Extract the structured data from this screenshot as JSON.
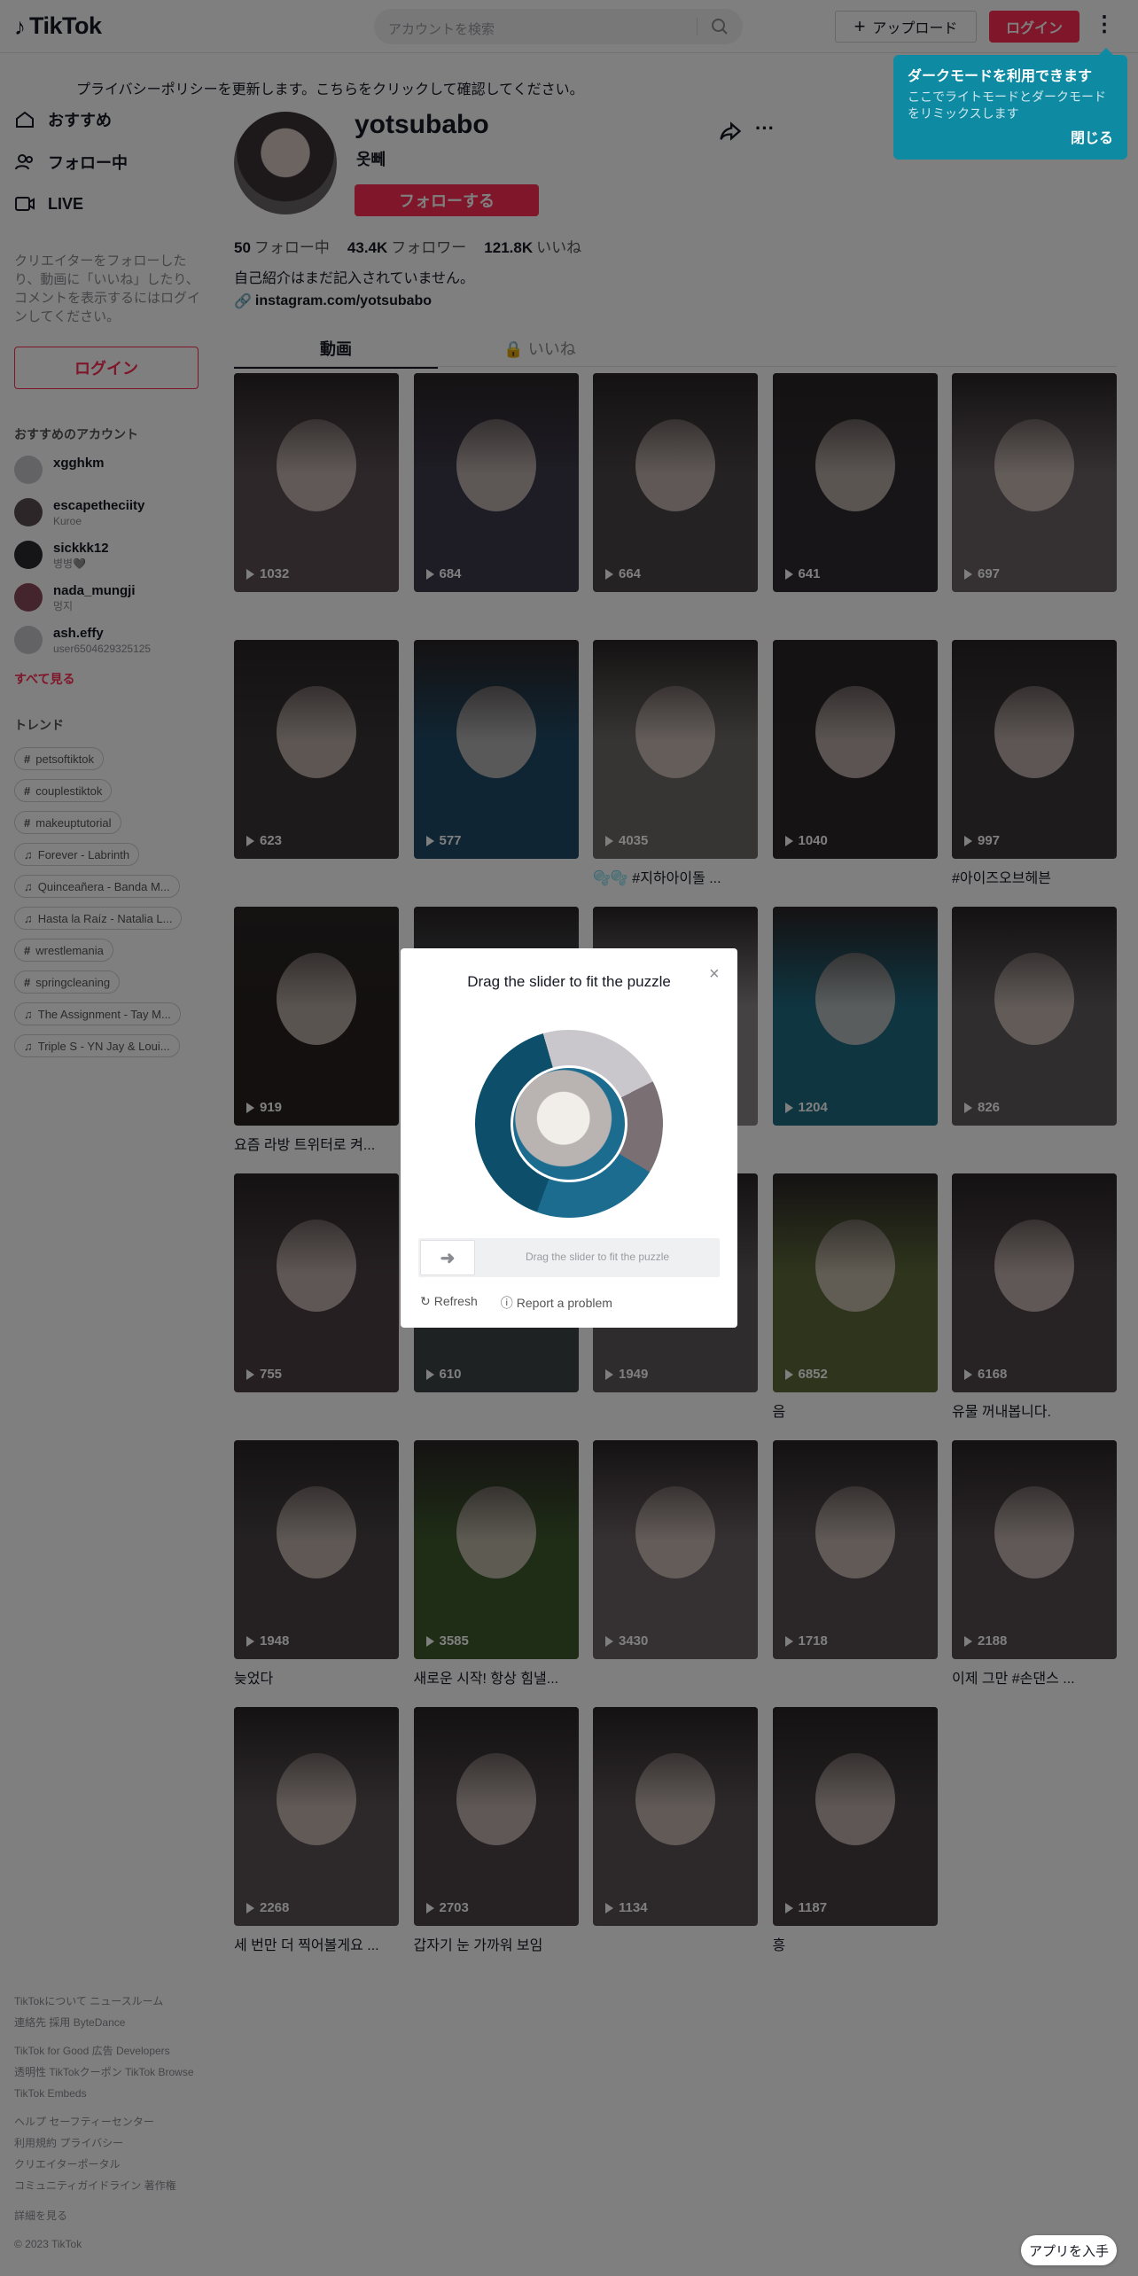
{
  "header": {
    "logo_text": "TikTok",
    "search_placeholder": "アカウントを検索",
    "upload_label": "アップロード",
    "login_label": "ログイン"
  },
  "banner": {
    "text": "プライバシーポリシーを更新します。こちらをクリックして確認してください。"
  },
  "sidebar": {
    "nav": [
      {
        "label": "おすすめ",
        "icon": "home-icon"
      },
      {
        "label": "フォロー中",
        "icon": "users-icon"
      },
      {
        "label": "LIVE",
        "icon": "live-icon"
      }
    ],
    "note": "クリエイターをフォローしたり、動画に「いいね」したり、コメントを表示するにはログインしてください。",
    "login_label": "ログイン",
    "suggested_heading": "おすすめのアカウント",
    "accounts": [
      {
        "name": "xgghkm",
        "sub": ""
      },
      {
        "name": "escapetheciity",
        "sub": "Kuroe"
      },
      {
        "name": "sickkk12",
        "sub": "병병🩶"
      },
      {
        "name": "nada_mungji",
        "sub": "멍지"
      },
      {
        "name": "ash.effy",
        "sub": "user6504629325125"
      }
    ],
    "see_all": "すべて見る",
    "trending_heading": "トレンド",
    "tags": [
      {
        "type": "hashtag",
        "label": "petsoftiktok"
      },
      {
        "type": "hashtag",
        "label": "couplestiktok"
      },
      {
        "type": "hashtag",
        "label": "makeuptutorial"
      },
      {
        "type": "music",
        "label": "Forever - Labrinth"
      },
      {
        "type": "music",
        "label": "Quinceañera - Banda M..."
      },
      {
        "type": "music",
        "label": "Hasta la Raíz - Natalia L..."
      },
      {
        "type": "hashtag",
        "label": "wrestlemania"
      },
      {
        "type": "hashtag",
        "label": "springcleaning"
      },
      {
        "type": "music",
        "label": "The Assignment - Tay M..."
      },
      {
        "type": "music",
        "label": "Triple S - YN Jay & Loui..."
      }
    ],
    "footer": [
      [
        "TikTokについて",
        "ニュースルーム"
      ],
      [
        "連絡先",
        "採用",
        "ByteDance"
      ],
      [
        "TikTok for Good",
        "広告",
        "Developers"
      ],
      [
        "透明性",
        "TikTokクーポン",
        "TikTok Browse"
      ],
      [
        "TikTok Embeds"
      ],
      [
        "ヘルプ",
        "セーフティーセンター"
      ],
      [
        "利用規約",
        "プライバシー"
      ],
      [
        "クリエイターポータル"
      ],
      [
        "コミュニティガイドライン",
        "著作権"
      ],
      [
        "詳細を見る"
      ],
      [
        "© 2023 TikTok"
      ]
    ]
  },
  "profile": {
    "handle": "yotsubabo",
    "nickname": "옷뻬",
    "follow_label": "フォローする",
    "stats": {
      "following_count": "50",
      "following_label": "フォロー中",
      "followers_count": "43.4K",
      "followers_label": "フォロワー",
      "likes_count": "121.8K",
      "likes_label": "いいね"
    },
    "bio": "自己紹介はまだ記入されていません。",
    "link": "instagram.com/yotsubabo",
    "tabs": {
      "videos": "動画",
      "liked": "いいね"
    }
  },
  "videos": [
    {
      "plays": "1032",
      "caption": ""
    },
    {
      "plays": "684",
      "caption": ""
    },
    {
      "plays": "664",
      "caption": ""
    },
    {
      "plays": "641",
      "caption": ""
    },
    {
      "plays": "697",
      "caption": ""
    },
    {
      "plays": "623",
      "caption": ""
    },
    {
      "plays": "577",
      "caption": ""
    },
    {
      "plays": "4035",
      "caption": "🫧🫧 #지하아이돌 ..."
    },
    {
      "plays": "1040",
      "caption": ""
    },
    {
      "plays": "997",
      "caption": "#아이즈오브헤븐"
    },
    {
      "plays": "919",
      "caption": "요즘 라방 트위터로 켜..."
    },
    {
      "plays": "",
      "caption": ""
    },
    {
      "plays": "",
      "caption": ""
    },
    {
      "plays": "1204",
      "caption": ""
    },
    {
      "plays": "826",
      "caption": ""
    },
    {
      "plays": "755",
      "caption": ""
    },
    {
      "plays": "610",
      "caption": ""
    },
    {
      "plays": "1949",
      "caption": ""
    },
    {
      "plays": "6852",
      "caption": "음"
    },
    {
      "plays": "6168",
      "caption": "유물 꺼내봅니다."
    },
    {
      "plays": "1948",
      "caption": "늦었다"
    },
    {
      "plays": "3585",
      "caption": "새로운 시작! 항상 힘낼..."
    },
    {
      "plays": "3430",
      "caption": ""
    },
    {
      "plays": "1718",
      "caption": ""
    },
    {
      "plays": "2188",
      "caption": "이제 그만 #손댄스 ..."
    },
    {
      "plays": "2268",
      "caption": "세 번만 더 찍어볼게요 ..."
    },
    {
      "plays": "2703",
      "caption": "갑자기 눈 가까워 보임"
    },
    {
      "plays": "1134",
      "caption": ""
    },
    {
      "plays": "1187",
      "caption": "흥"
    }
  ],
  "tooltip": {
    "title": "ダークモードを利用できます",
    "desc": "ここでライトモードとダークモードをリミックスします",
    "close_label": "閉じる"
  },
  "captcha": {
    "title": "Drag the slider to fit the puzzle",
    "slider_text": "Drag the slider to fit the puzzle",
    "refresh_label": "Refresh",
    "report_label": "Report a problem"
  },
  "app_button": "アプリを入手",
  "colors": {
    "brand": "#fe2c55",
    "tooltip": "#0e8aa3"
  }
}
